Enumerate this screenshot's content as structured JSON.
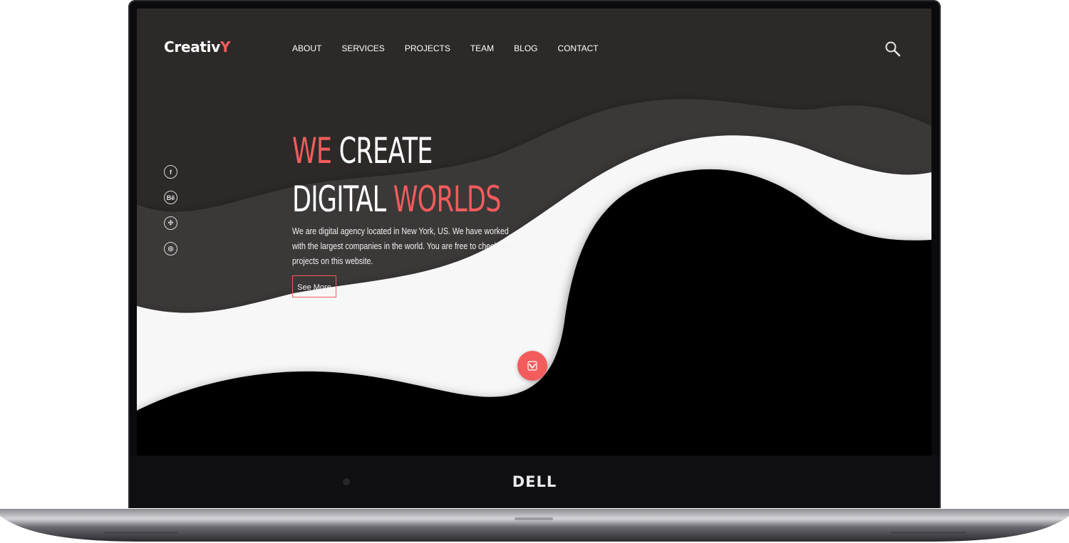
{
  "site": {
    "logo_main": "Creativ",
    "logo_accent": "Y",
    "nav": [
      "ABOUT",
      "SERVICES",
      "PROJECTS",
      "TEAM",
      "BLOG",
      "CONTACT"
    ],
    "social_icons": [
      "facebook-icon",
      "behance-icon",
      "dribbble-icon",
      "instagram-icon"
    ],
    "social_glyphs": [
      "f",
      "Bē",
      "✣",
      "◎"
    ],
    "hero": {
      "line1_accent": "WE",
      "line1_rest": "CREATE",
      "line2_rest": "DIGITAL",
      "line2_accent": "WORLDS",
      "description": "We are digital agency located in New York, US. We have worked with the largest companies in the world. You are free to check our projects on this website.",
      "button_label": "See More"
    }
  },
  "device": {
    "brand": "DELL"
  },
  "colors": {
    "accent": "#f25c5c",
    "background": "#2d2929",
    "wave_mid": "#3a3737",
    "wave_light": "#f7f7f7",
    "wave_dark": "#000000"
  }
}
